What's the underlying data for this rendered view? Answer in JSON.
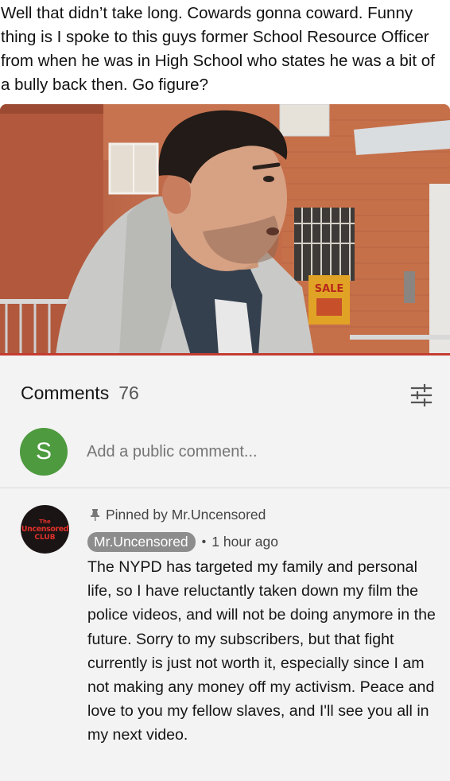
{
  "post": {
    "caption": "Well that didn’t take long. Cowards gonna coward. Funny thing is I spoke to this guys former School Resource Officer from when he was in High School who states he was a bit of a bully back then. Go figure?"
  },
  "video": {
    "sign_text": "SALE"
  },
  "comments": {
    "title": "Comments",
    "count": "76",
    "filter_icon": "sort-sliders-icon",
    "add": {
      "avatar_letter": "S",
      "avatar_color": "#4e9a3f",
      "placeholder": "Add a public comment..."
    },
    "pinned_comment": {
      "avatar_lines": [
        "The",
        "Uncensored",
        "CLUB"
      ],
      "pinned_label": "Pinned by Mr.Uncensored",
      "author": "Mr.Uncensored",
      "separator": "•",
      "time": "1 hour ago",
      "text": "The NYPD has targeted my family and personal life, so I have reluctantly taken down my film the police videos, and will not be doing anymore in the future. Sorry to my subscribers, but that fight currently is just not worth it, especially since I am not making any money off my activism. Peace and love to you my fellow slaves, and I'll see you all in my next video."
    }
  }
}
